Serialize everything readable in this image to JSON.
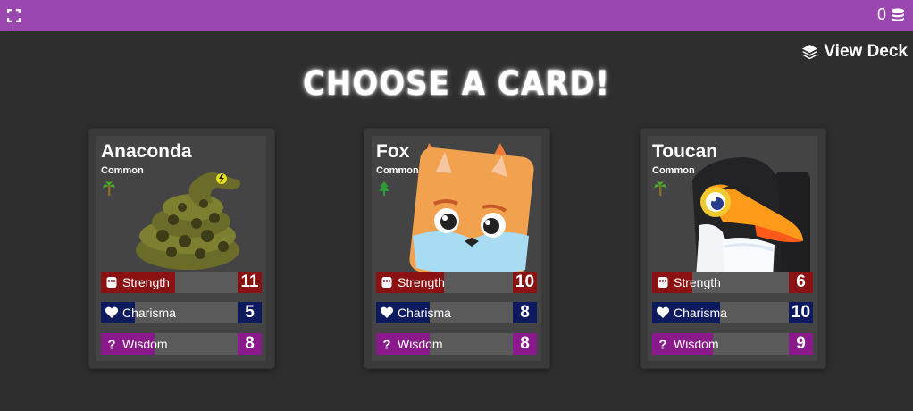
{
  "topbar": {
    "coin_count": "0",
    "bg_color": "#9a47b0"
  },
  "header": {
    "view_deck_label": "View Deck",
    "title": "CHOOSE A CARD!"
  },
  "stat_labels": {
    "strength": "Strength",
    "charisma": "Charisma",
    "wisdom": "Wisdom"
  },
  "colors": {
    "strength": "#8b1212",
    "charisma": "#0e1a5e",
    "wisdom": "#8a1a8c"
  },
  "cards": [
    {
      "name": "Anaconda",
      "rarity": "Common",
      "biome_icon": "palm-tree-icon",
      "strength": "11",
      "charisma": "5",
      "wisdom": "8"
    },
    {
      "name": "Fox",
      "rarity": "Common",
      "biome_icon": "pine-tree-icon",
      "strength": "10",
      "charisma": "8",
      "wisdom": "8"
    },
    {
      "name": "Toucan",
      "rarity": "Common",
      "biome_icon": "palm-tree-icon",
      "strength": "6",
      "charisma": "10",
      "wisdom": "9"
    }
  ]
}
